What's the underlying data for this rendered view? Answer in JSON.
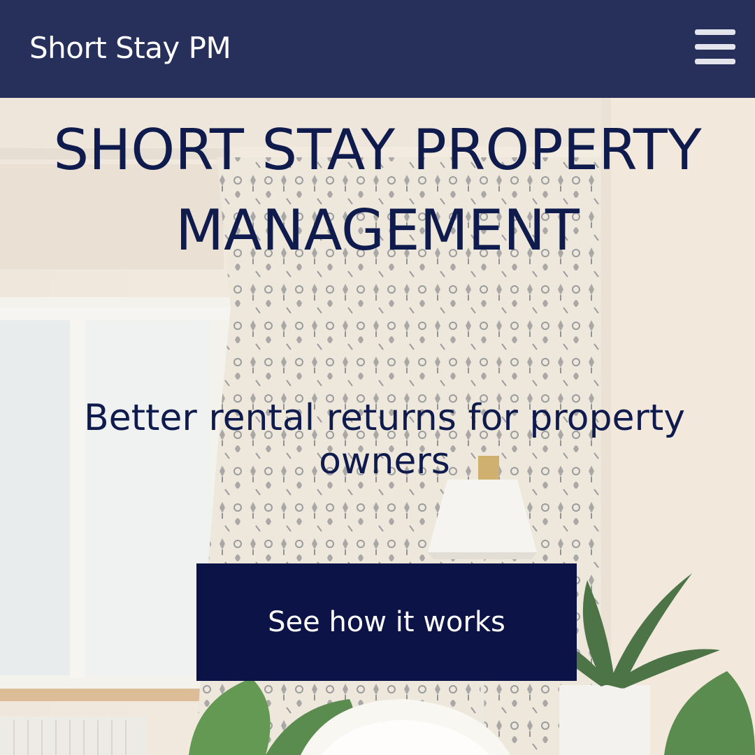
{
  "header": {
    "brand": "Short Stay PM",
    "menu_icon": "hamburger-menu-icon"
  },
  "hero": {
    "title": "SHORT STAY PROPERTY MANAGEMENT",
    "subtitle": "Better rental returns for property owners",
    "cta_label": "See how it works",
    "background": "living-room-photo"
  },
  "colors": {
    "nav_bg": "#27305a",
    "heading": "#0f1a4d",
    "cta_bg": "#0c1447",
    "cta_text": "#ffffff"
  }
}
